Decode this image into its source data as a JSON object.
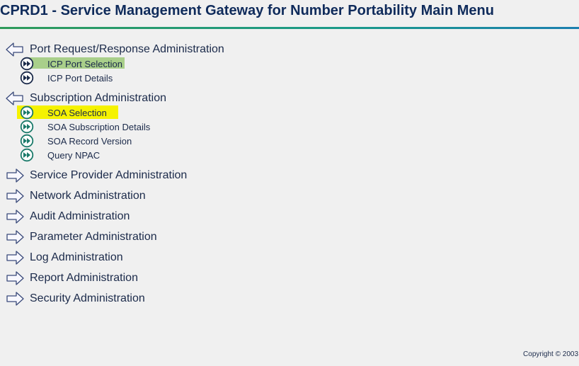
{
  "header": {
    "title": "CPRD1 - Service Management Gateway for Number Portability Main Menu"
  },
  "menu": {
    "sections": [
      {
        "label": "Port Request/Response Administration",
        "state": "expanded",
        "items": [
          {
            "label": "ICP Port Selection",
            "highlight": "#a9cf8a"
          },
          {
            "label": "ICP Port Details"
          }
        ]
      },
      {
        "label": "Subscription Administration",
        "state": "expanded",
        "items": [
          {
            "label": "SOA Selection",
            "highlight": "#f5f200"
          },
          {
            "label": "SOA Subscription Details"
          },
          {
            "label": "SOA Record Version"
          },
          {
            "label": "Query NPAC"
          }
        ]
      },
      {
        "label": "Service Provider Administration",
        "state": "collapsed"
      },
      {
        "label": "Network Administration",
        "state": "collapsed"
      },
      {
        "label": "Audit Administration",
        "state": "collapsed"
      },
      {
        "label": "Parameter Administration",
        "state": "collapsed"
      },
      {
        "label": "Log Administration",
        "state": "collapsed"
      },
      {
        "label": "Report Administration",
        "state": "collapsed"
      },
      {
        "label": "Security Administration",
        "state": "collapsed"
      }
    ]
  },
  "footer": {
    "copyright": "Copyright © 2003"
  },
  "icons": {
    "expanded": "left-arrow-icon",
    "collapsed": "right-arrow-icon",
    "item_port": "fast-forward-icon",
    "item_soa": "fast-forward-icon"
  },
  "colors": {
    "title": "#0f2b5b",
    "rule_start": "#2e9a5a",
    "rule_end": "#1b7fb0",
    "port_icon": "#1b2a4a",
    "soa_icon": "#1a7a6a"
  }
}
